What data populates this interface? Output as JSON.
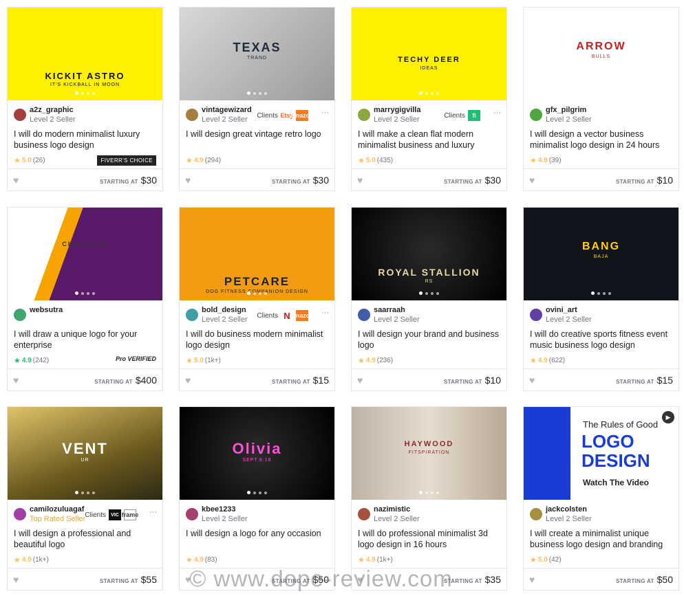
{
  "starting_label": "STARTING AT",
  "clients_label": "Clients",
  "watermark": "© www.dope-review.com",
  "cards": [
    {
      "seller": "a2z_graphic",
      "level": "Level 2 Seller",
      "title": "I will do modern minimalist luxury business logo design",
      "rating": "5.0",
      "reviews": "(26)",
      "badge": "FIVERR'S CHOICE",
      "price": "$30",
      "thumb_text": "KICKIT ASTRO",
      "thumb_sub": "IT'S KICKBALL IN MOON"
    },
    {
      "seller": "vintagewizard",
      "level": "Level 2 Seller",
      "title": "I will design great vintage retro logo",
      "rating": "4.9",
      "reviews": "(294)",
      "price": "$30",
      "clients": [
        "Etsy",
        "amazon"
      ],
      "thumb_text": "TEXAS",
      "thumb_sub": "TRAND"
    },
    {
      "seller": "marrygigvilla",
      "level": "Level 2 Seller",
      "title": "I will make a clean flat modern minimalist business and luxury brand...",
      "rating": "5.0",
      "reviews": "(435)",
      "price": "$30",
      "clients": [
        "fi"
      ],
      "thumb_text": "TECHY DEER",
      "thumb_sub": "IDEAS"
    },
    {
      "seller": "gfx_pilgrim",
      "level": "Level 2 Seller",
      "title": "I will design a vector business minimalist logo design in 24 hours",
      "rating": "4.9",
      "reviews": "(39)",
      "price": "$10",
      "thumb_text": "ARROW",
      "thumb_sub": "BULLS"
    },
    {
      "seller": "websutra",
      "level": "",
      "title": "I will draw a unique logo for your enterprise",
      "rating": "4.9",
      "reviews": "(242)",
      "badge": "Pro VERIFIED",
      "price": "$400",
      "teal": true,
      "thumb_text": "Chameleon"
    },
    {
      "seller": "bold_design",
      "level": "Level 2 Seller",
      "title": "I will do business modern minimalist logo design",
      "rating": "5.0",
      "reviews": "(1k+)",
      "price": "$15",
      "clients": [
        "N",
        "amazon"
      ],
      "thumb_text": "PETCARE",
      "thumb_sub": "DOG FITNESS COMPANION DESIGN"
    },
    {
      "seller": "saarraah",
      "level": "Level 2 Seller",
      "title": "I will design your brand and business logo",
      "rating": "4.9",
      "reviews": "(236)",
      "price": "$10",
      "thumb_text": "ROYAL STALLION",
      "thumb_sub": "RS"
    },
    {
      "seller": "ovini_art",
      "level": "Level 2 Seller",
      "title": "I will do creative sports fitness event music business logo design",
      "rating": "4.9",
      "reviews": "(622)",
      "price": "$15",
      "thumb_text": "BANG",
      "thumb_sub": "BAJA"
    },
    {
      "seller": "camilozuluagaf",
      "level": "Top Rated Seller",
      "top": true,
      "title": "I will design a professional and beautiful logo",
      "rating": "4.9",
      "reviews": "(1k+)",
      "price": "$55",
      "clients": [
        "VIC",
        "frame"
      ],
      "thumb_text": "VENT",
      "thumb_sub": "UR"
    },
    {
      "seller": "kbee1233",
      "level": "Level 2 Seller",
      "title": "I will design a logo for any occasion",
      "rating": "4.9",
      "reviews": "(83)",
      "price": "$50",
      "thumb_text": "Olivia",
      "thumb_sub": "SEPT.8.18"
    },
    {
      "seller": "nazimistic",
      "level": "Level 2 Seller",
      "title": "I will do professional minimalist 3d logo design in 16 hours",
      "rating": "4.9",
      "reviews": "(1k+)",
      "price": "$35",
      "thumb_text": "HAYWOOD",
      "thumb_sub": "FITSPIRATION"
    },
    {
      "seller": "jackcolsten",
      "level": "Level 2 Seller",
      "title": "I will create a minimalist unique business logo design and branding",
      "rating": "5.0",
      "reviews": "(42)",
      "price": "$50",
      "thumb_text": "LOGO DESIGN",
      "thumb_sub": "Watch The Video",
      "thumb_top": "The Rules of Good"
    }
  ],
  "colors": {
    "accent": "#1dbf73",
    "star": "#ffbe5b",
    "top_rated": "#e1a936"
  }
}
